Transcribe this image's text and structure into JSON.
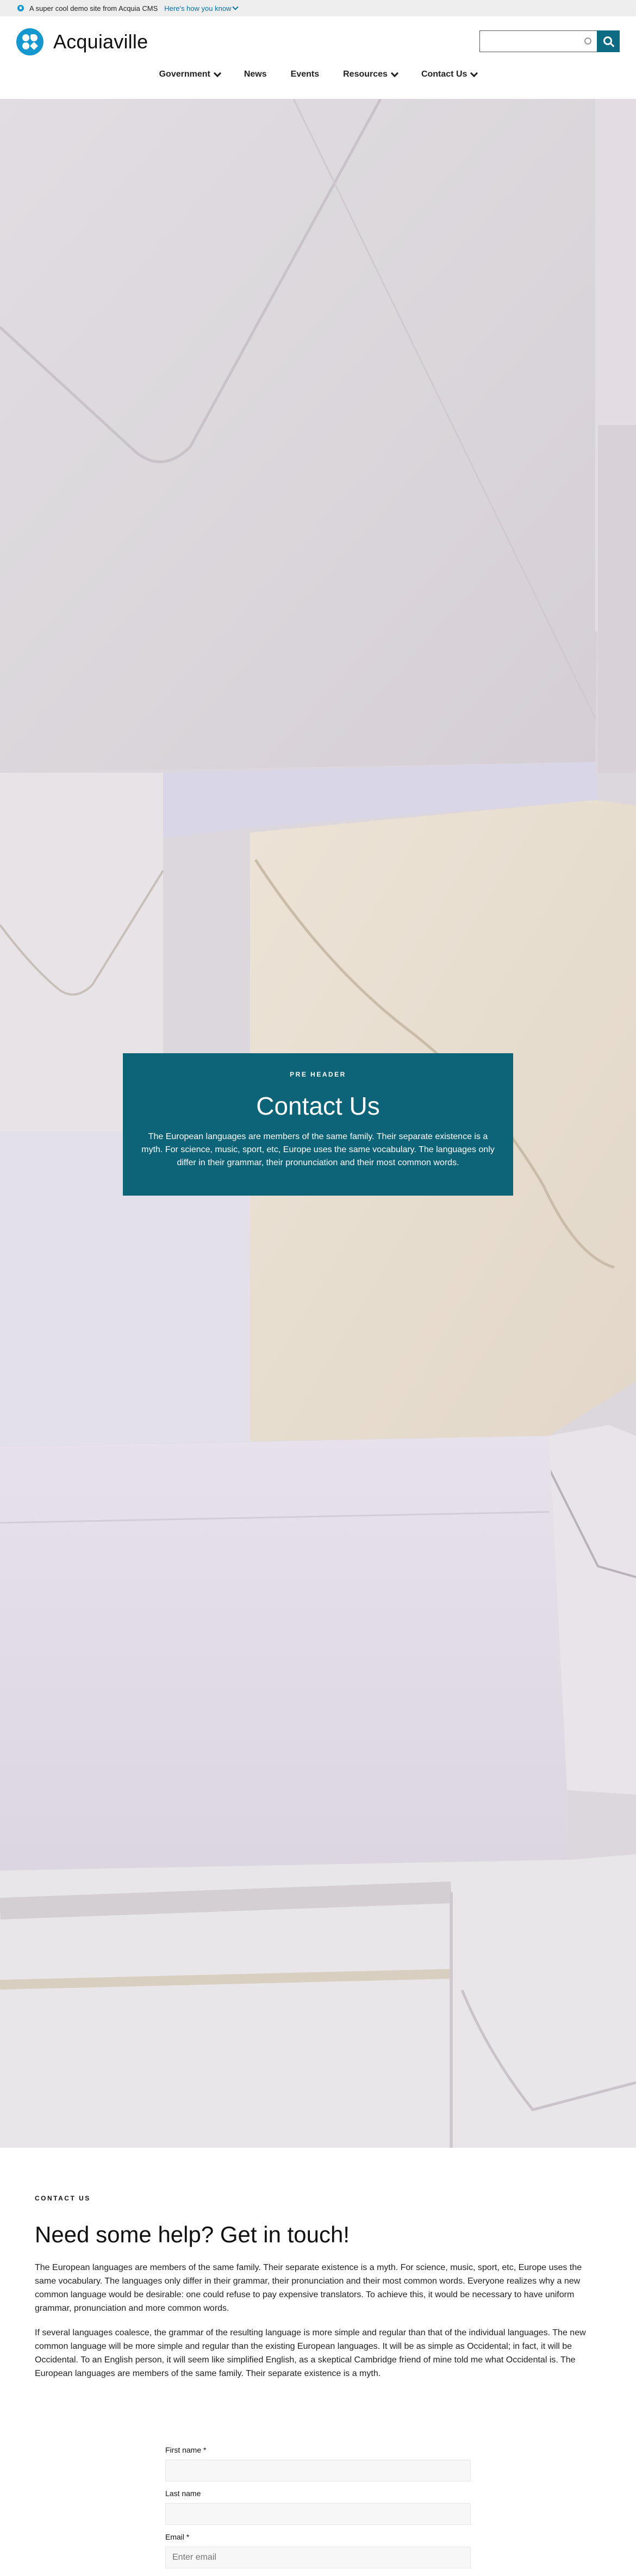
{
  "announcement": {
    "text": "A super cool demo site from Acquia CMS",
    "link": "Here's how you know"
  },
  "site": {
    "name": "Acquiaville"
  },
  "search": {
    "placeholder": "",
    "value": ""
  },
  "nav": {
    "items": [
      {
        "label": "Government",
        "has_dropdown": true
      },
      {
        "label": "News",
        "has_dropdown": false
      },
      {
        "label": "Events",
        "has_dropdown": false
      },
      {
        "label": "Resources",
        "has_dropdown": true
      },
      {
        "label": "Contact Us",
        "has_dropdown": true
      }
    ]
  },
  "hero": {
    "pre_header": "PRE HEADER",
    "title": "Contact Us",
    "text": "The European languages are members of the same family. Their separate existence is a myth. For science, music, sport, etc, Europe uses the same vocabulary. The languages only differ in their grammar, their pronunciation and their most common words."
  },
  "content": {
    "eyebrow": "CONTACT US",
    "heading": "Need some help? Get in touch!",
    "paragraphs": [
      "The European languages are members of the same family. Their separate existence is a myth. For science, music, sport, etc, Europe uses the same vocabulary. The languages only differ in their grammar, their pronunciation and their most common words. Everyone realizes why a new common language would be desirable: one could refuse to pay expensive translators. To achieve this, it would be necessary to have uniform grammar, pronunciation and more common words.",
      "If several languages coalesce, the grammar of the resulting language is more simple and regular than that of the individual languages. The new common language will be more simple and regular than the existing European languages. It will be as simple as Occidental; in fact, it will be Occidental. To an English person, it will seem like simplified English, as a skeptical Cambridge friend of mine told me what Occidental is. The European languages are members of the same family. Their separate existence is a myth."
    ]
  },
  "form": {
    "first_name": {
      "label": "First name",
      "required_mark": "*",
      "value": ""
    },
    "last_name": {
      "label": "Last name",
      "required_mark": "",
      "value": ""
    },
    "email": {
      "label": "Email",
      "required_mark": "*",
      "placeholder": "Enter email"
    }
  },
  "colors": {
    "brand": "#1598cf",
    "accent": "#0d6479",
    "search_button": "#0d6c84"
  }
}
